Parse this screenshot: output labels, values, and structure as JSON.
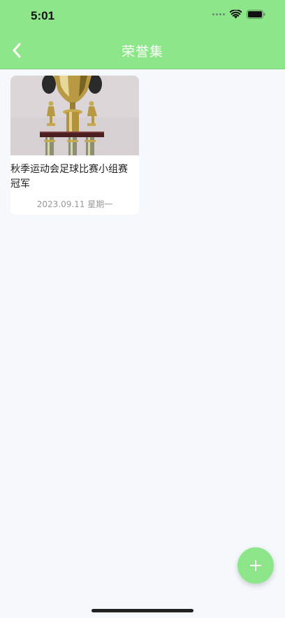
{
  "status_bar": {
    "time": "5:01"
  },
  "header": {
    "title": "荣誉集",
    "background_color": "#8ee68a"
  },
  "cards": [
    {
      "title": "秋季运动会足球比赛小组赛冠军",
      "date": "2023.09.11 星期一",
      "image": "trophy-photo"
    }
  ],
  "fab": {
    "label": "+",
    "icon": "plus-icon"
  },
  "icons": {
    "back": "chevron-left-icon",
    "wifi": "wifi-icon",
    "battery": "battery-icon",
    "signal": "signal-icon"
  }
}
